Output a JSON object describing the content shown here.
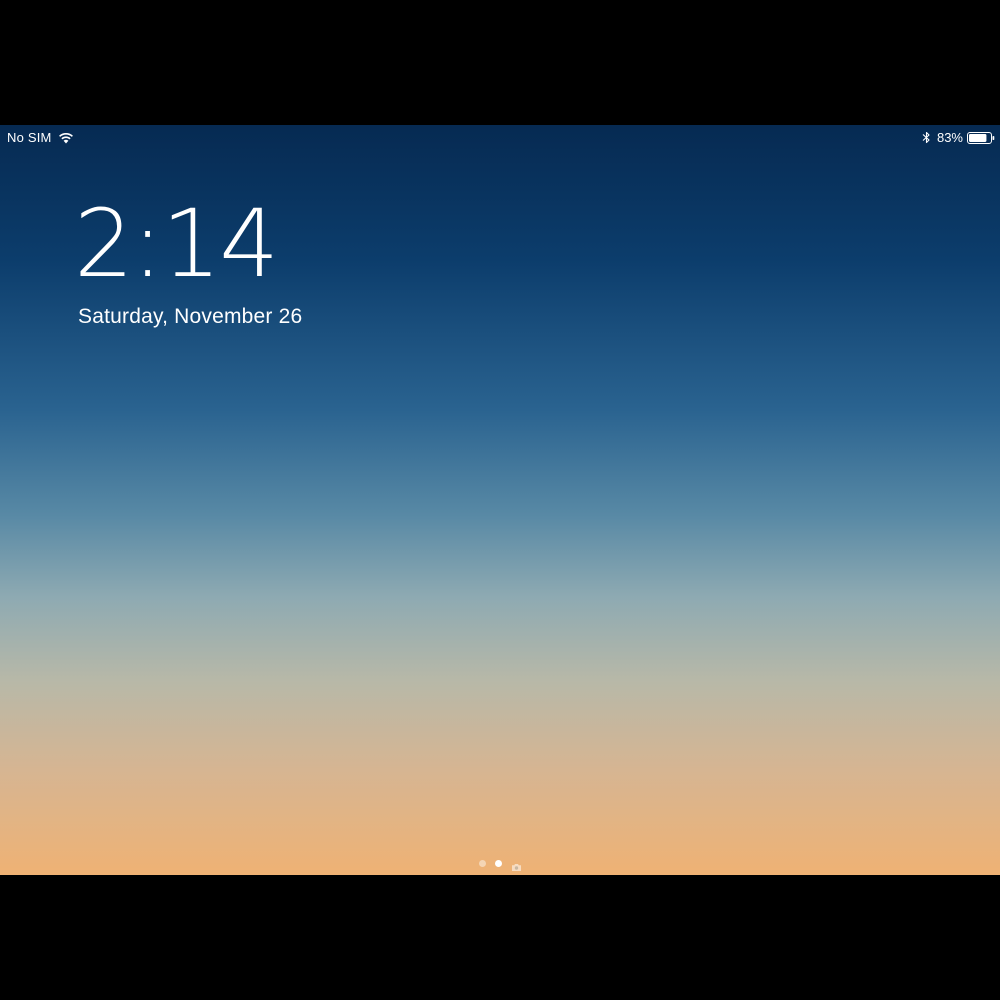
{
  "status_bar": {
    "carrier": "No SIM",
    "wifi_icon": "wifi-icon",
    "bluetooth_icon": "bluetooth-icon",
    "battery_percent": "83%",
    "battery_level": 0.83
  },
  "lock_screen": {
    "time": "2:14",
    "date": "Saturday, November 26"
  },
  "page_indicator": {
    "pages": 2,
    "active_index": 1,
    "camera_icon": "camera-icon"
  },
  "colors": {
    "wallpaper_top": "#062a52",
    "wallpaper_bottom": "#efb274",
    "text": "#ffffff"
  }
}
